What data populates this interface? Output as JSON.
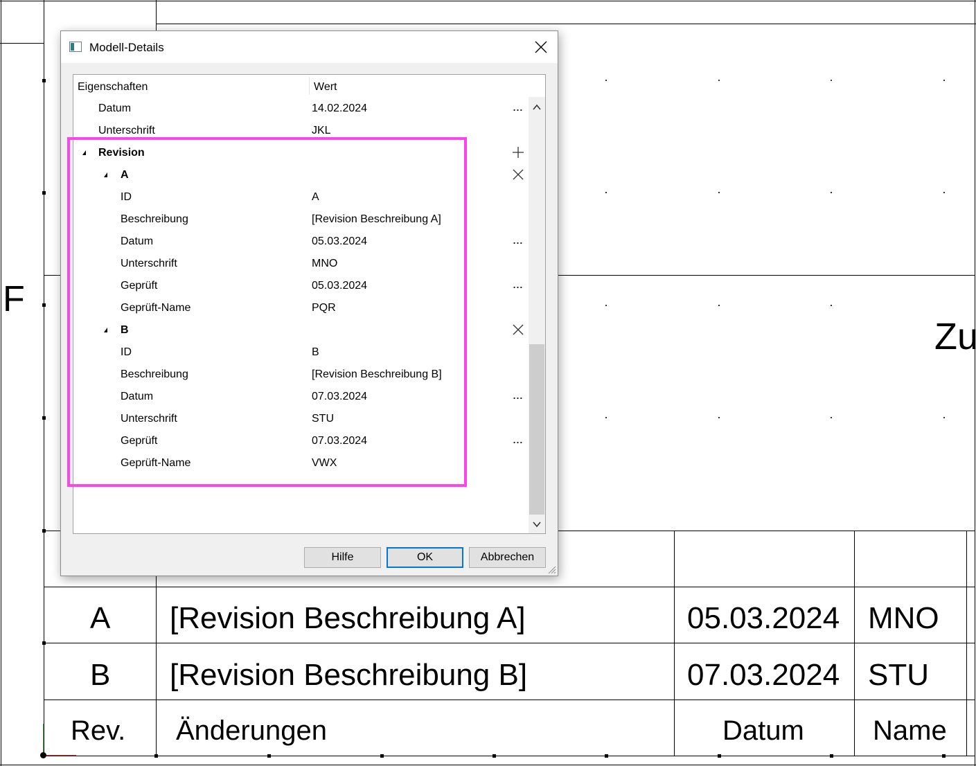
{
  "drawing": {
    "side_letter": "F",
    "partial_label": "Zu",
    "table_rows": [
      {
        "rev": "A",
        "description": "[Revision Beschreibung A]",
        "date": "05.03.2024",
        "name": "MNO"
      },
      {
        "rev": "B",
        "description": "[Revision Beschreibung B]",
        "date": "07.03.2024",
        "name": "STU"
      }
    ],
    "table_header": {
      "rev": "Rev.",
      "changes": "Änderungen",
      "date": "Datum",
      "name": "Name"
    }
  },
  "dialog": {
    "title": "Modell-Details",
    "columns": {
      "property": "Eigenschaften",
      "value": "Wert"
    },
    "rows": [
      {
        "key": "Datum",
        "value": "14.02.2024",
        "action": "ellipsis"
      },
      {
        "key": "Unterschrift",
        "value": "JKL",
        "action": ""
      },
      {
        "key": "Revision",
        "value": "",
        "action": "add",
        "group": true
      },
      {
        "key": "A",
        "value": "",
        "action": "remove",
        "group": true
      },
      {
        "key": "ID",
        "value": "A",
        "action": ""
      },
      {
        "key": "Beschreibung",
        "value": "[Revision Beschreibung A]",
        "action": ""
      },
      {
        "key": "Datum",
        "value": "05.03.2024",
        "action": "ellipsis"
      },
      {
        "key": "Unterschrift",
        "value": "MNO",
        "action": ""
      },
      {
        "key": "Geprüft",
        "value": "05.03.2024",
        "action": "ellipsis"
      },
      {
        "key": "Geprüft-Name",
        "value": "PQR",
        "action": ""
      },
      {
        "key": "B",
        "value": "",
        "action": "remove",
        "group": true
      },
      {
        "key": "ID",
        "value": "B",
        "action": ""
      },
      {
        "key": "Beschreibung",
        "value": "[Revision Beschreibung B]",
        "action": ""
      },
      {
        "key": "Datum",
        "value": "07.03.2024",
        "action": "ellipsis"
      },
      {
        "key": "Unterschrift",
        "value": "STU",
        "action": ""
      },
      {
        "key": "Geprüft",
        "value": "07.03.2024",
        "action": "ellipsis"
      },
      {
        "key": "Geprüft-Name",
        "value": "VWX",
        "action": ""
      }
    ],
    "buttons": {
      "help": "Hilfe",
      "ok": "OK",
      "cancel": "Abbrechen"
    },
    "ellipsis_glyph": "...",
    "highlight_color": "#ff44ee",
    "accent_color": "#0078d7"
  }
}
